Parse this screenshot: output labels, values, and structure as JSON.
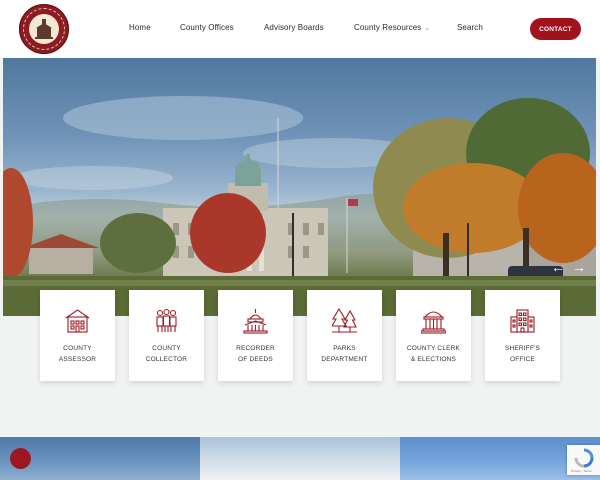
{
  "header": {
    "logo_icon": "county-seal-logo",
    "nav": [
      {
        "label": "Home"
      },
      {
        "label": "County Offices"
      },
      {
        "label": "Advisory Boards"
      },
      {
        "label": "County Resources",
        "has_dropdown": true
      },
      {
        "label": "Search"
      }
    ],
    "contact_label": "CONTACT"
  },
  "hero": {
    "prev_icon": "arrow-left-icon",
    "next_icon": "arrow-right-icon"
  },
  "offices": [
    {
      "line1": "COUNTY",
      "line2": "ASSESSOR",
      "icon": "building-icon"
    },
    {
      "line1": "COUNTY",
      "line2": "COLLECTOR",
      "icon": "people-icon"
    },
    {
      "line1": "RECORDER",
      "line2": "OF DEEDS",
      "icon": "capitol-icon"
    },
    {
      "line1": "PARKS",
      "line2": "DEPARTMENT",
      "icon": "trees-icon"
    },
    {
      "line1": "COUNTY CLERK",
      "line2": "& ELECTIONS",
      "icon": "courthouse-icon"
    },
    {
      "line1": "SHERIFF'S",
      "line2": "OFFICE",
      "icon": "office-building-icon"
    }
  ],
  "recaptcha": {
    "footer": "Privacy - Terms"
  },
  "colors": {
    "accent": "#a2121d",
    "icon": "#9b1c24"
  }
}
